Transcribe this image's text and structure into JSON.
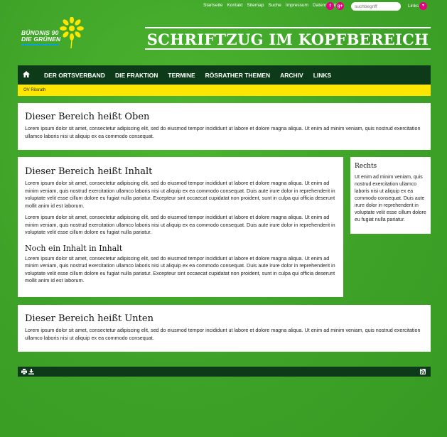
{
  "topbar": {
    "nav": [
      "Startseite",
      "Kontakt",
      "Sitemap",
      "Suche",
      "Impressum",
      "Datenschutz"
    ],
    "facebook_glyph": "f",
    "googleplus_glyph": "g+",
    "search_placeholder": "suchbegriff",
    "links_label": "Links",
    "links_toggle_glyph": "▾"
  },
  "header": {
    "logo_line1": "BÜNDNIS 90",
    "logo_line2": "DIE GRÜNEN",
    "headline": "SCHRIFTZUG IM KOPFBEREICH"
  },
  "nav": {
    "home_icon": "home-icon",
    "items": [
      "DER ORTSVERBAND",
      "DIE FRAKTION",
      "TERMINE",
      "RÖSRATHER THEMEN",
      "ARCHIV",
      "LINKS"
    ]
  },
  "breadcrumb": "OV Rösrath",
  "top_box": {
    "title": "Dieser Bereich heißt Oben",
    "text": "Lorem ipsum dolor sit amet, consectetur adipiscing elit, sed do eiusmod tempor incididunt ut labore et dolore magna aliqua. Ut enim ad minim veniam, quis nostrud exercitation ullamco laboris nisi ut aliquip ex ea commodo consequat."
  },
  "main_box": {
    "title": "Dieser Bereich heißt Inhalt",
    "p1": "Lorem ipsum dolor sit amet, consectetur adipiscing elit, sed do eiusmod tempor incididunt ut labore et dolore magna aliqua. Ut enim ad minim veniam, quis nostrud exercitation ullamco laboris nisi ut aliquip ex ea commodo consequat. Duis aute irure dolor in reprehenderit in voluptate velit esse cillum dolore eu fugiat nulla pariatur. Excepteur sint occaecat cupidatat non proident, sunt in culpa qui officia deserunt mollit anim id est laborum.",
    "p2": "Lorem ipsum dolor sit amet, consectetur adipiscing elit, sed do eiusmod tempor incididunt ut labore et dolore magna aliqua. Ut enim ad minim veniam, quis nostrud exercitation ullamco laboris nisi ut aliquip ex ea commodo consequat. Duis aute irure dolor in reprehenderit in voluptate velit esse cillum dolore eu fugiat nulla pariatur.",
    "subtitle": "Noch ein Inhalt in Inhalt",
    "p3": "Lorem ipsum dolor sit amet, consectetur adipiscing elit, sed do eiusmod tempor incididunt ut labore et dolore magna aliqua. Ut enim ad minim veniam, quis nostrud exercitation ullamco laboris nisi ut aliquip ex ea commodo consequat. Duis aute irure dolor in reprehenderit in voluptate velit esse cillum dolore eu fugiat nulla pariatur. Excepteur sint occaecat cupidatat non proident, sunt in culpa qui officia deserunt mollit anim id est laborum."
  },
  "right_box": {
    "title": "Rechts",
    "text": "Ut enim ad minim veniam, quis nostrud exercitation ullamco laboris nisi ut aliquip ex ea commodo consequat. Duis aute irure dolor in reprehenderit in voluptate velit esse cillum dolore eu fugiat nulla pariatur."
  },
  "bottom_box": {
    "title": "Dieser Bereich heißt Unten",
    "text": "Lorem ipsum dolor sit amet, consectetur adipiscing elit, sed do eiusmod tempor incididunt ut labore et dolore magna aliqua. Ut enim ad minim veniam, quis nostrud exercitation ullamco laboris nisi ut aliquip ex ea commodo consequat."
  },
  "footer": {
    "icons": [
      "print-icon",
      "download-icon",
      "rss-icon"
    ]
  },
  "colors": {
    "background_green": "#3fa52a",
    "nav_dark_green": "#0d3b1a",
    "breadcrumb_yellow": "#ffe500",
    "social_magenta": "#e6007e"
  }
}
